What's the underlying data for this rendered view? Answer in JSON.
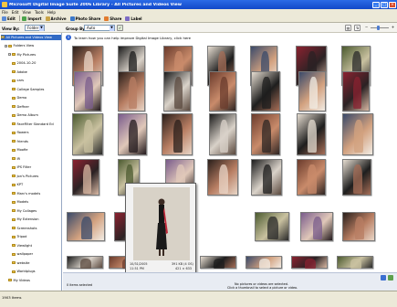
{
  "window": {
    "title": "Microsoft Digital Image Suite 2006 Library - All Pictures and Videos View",
    "minimize": "_",
    "maximize": "□",
    "close": "×"
  },
  "menu": [
    "File",
    "Edit",
    "View",
    "Tools",
    "Help"
  ],
  "toolbar": {
    "edit": "Edit",
    "import": "Import",
    "archive": "Archive",
    "photo_share": "Photo Share",
    "share": "Share",
    "label": "Label"
  },
  "viewbar": {
    "view_by_label": "View By:",
    "view_by_value": "Folder",
    "group_by_label": "Group By:",
    "group_by_value": "Auto"
  },
  "info_message": "To learn how you can help improve Digital Image Library, click here",
  "sidebar": {
    "items": [
      {
        "label": "All Pictures and Videos View",
        "selected": true,
        "indent": 0,
        "expander": ""
      },
      {
        "label": "Folders View",
        "selected": false,
        "indent": 1,
        "expander": "−"
      },
      {
        "label": "My Pictures",
        "selected": false,
        "indent": 2,
        "expander": "−"
      },
      {
        "label": "2004-10-20",
        "selected": false,
        "indent": 3,
        "expander": ""
      },
      {
        "label": "Adobe",
        "selected": false,
        "indent": 3,
        "expander": ""
      },
      {
        "label": "cars",
        "selected": false,
        "indent": 3,
        "expander": ""
      },
      {
        "label": "College Samples",
        "selected": false,
        "indent": 3,
        "expander": ""
      },
      {
        "label": "Demo",
        "selected": false,
        "indent": 3,
        "expander": ""
      },
      {
        "label": "Deffner",
        "selected": false,
        "indent": 3,
        "expander": ""
      },
      {
        "label": "Demo Album",
        "selected": false,
        "indent": 3,
        "expander": ""
      },
      {
        "label": "FaceFilter Standard Ed",
        "selected": false,
        "indent": 3,
        "expander": ""
      },
      {
        "label": "flowers",
        "selected": false,
        "indent": 3,
        "expander": ""
      },
      {
        "label": "friends",
        "selected": false,
        "indent": 3,
        "expander": ""
      },
      {
        "label": "Moofie",
        "selected": false,
        "indent": 3,
        "expander": ""
      },
      {
        "label": "IR",
        "selected": false,
        "indent": 3,
        "expander": ""
      },
      {
        "label": "IPS Filter",
        "selected": false,
        "indent": 3,
        "expander": ""
      },
      {
        "label": "Jon's Pictures",
        "selected": false,
        "indent": 3,
        "expander": ""
      },
      {
        "label": "KPT",
        "selected": false,
        "indent": 3,
        "expander": ""
      },
      {
        "label": "Marc's models",
        "selected": false,
        "indent": 3,
        "expander": ""
      },
      {
        "label": "Models",
        "selected": false,
        "indent": 3,
        "expander": ""
      },
      {
        "label": "My Collages",
        "selected": false,
        "indent": 3,
        "expander": ""
      },
      {
        "label": "My Extension",
        "selected": false,
        "indent": 3,
        "expander": ""
      },
      {
        "label": "Screenshots",
        "selected": false,
        "indent": 3,
        "expander": ""
      },
      {
        "label": "Tripod",
        "selected": false,
        "indent": 3,
        "expander": ""
      },
      {
        "label": "Viewlight",
        "selected": false,
        "indent": 3,
        "expander": ""
      },
      {
        "label": "wallpaper",
        "selected": false,
        "indent": 3,
        "expander": ""
      },
      {
        "label": "website",
        "selected": false,
        "indent": 3,
        "expander": ""
      },
      {
        "label": "Worldplugs",
        "selected": false,
        "indent": 3,
        "expander": ""
      },
      {
        "label": "My Videos",
        "selected": false,
        "indent": 2,
        "expander": ""
      }
    ]
  },
  "preview": {
    "date": "10/31/2005",
    "time": "11:51 PM",
    "size": "391 KB (4 OS)",
    "dimensions": "421 × 633"
  },
  "tasks": {
    "selection_count": "0 items selected",
    "hint_line1": "No pictures or videos are selected.",
    "hint_line2": "Click a thumbnail to select a picture or video."
  },
  "status": {
    "left": "1903 Items"
  },
  "colors": {
    "titlebar": "#1d5ad8",
    "selection": "#316ac5",
    "folder": "#e8c24a"
  }
}
